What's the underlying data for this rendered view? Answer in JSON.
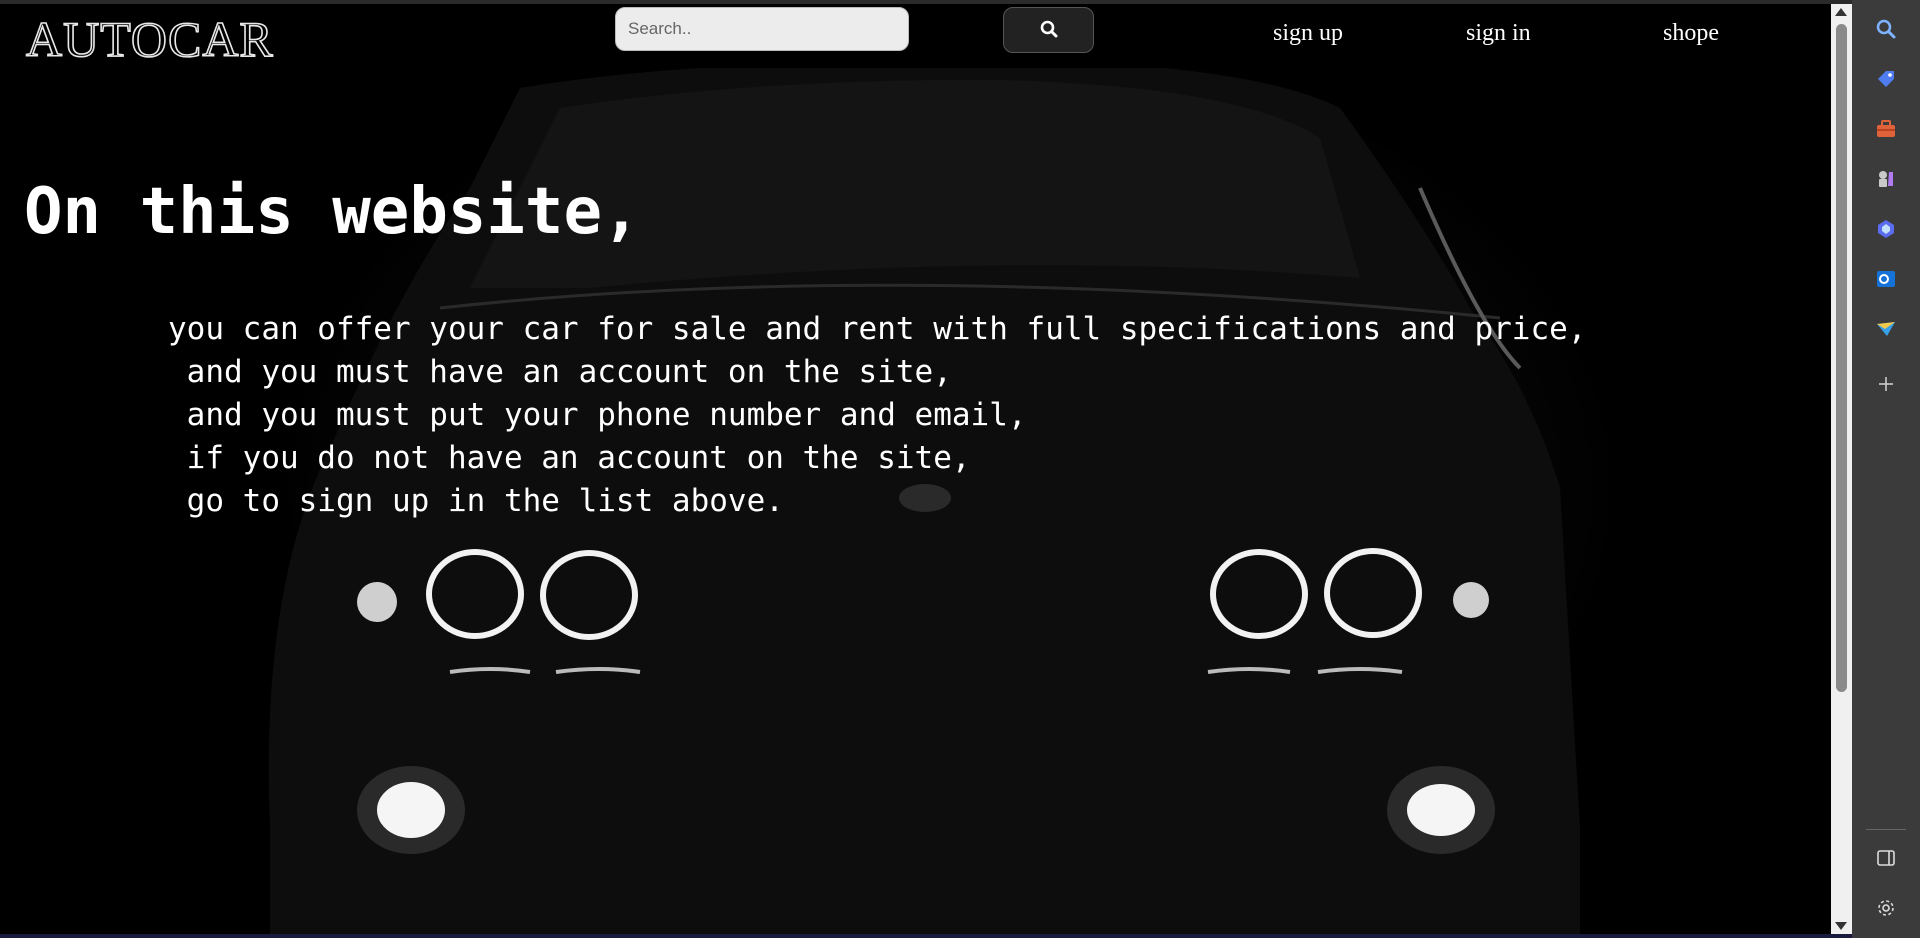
{
  "brand": {
    "logo_text": "AUTOCAR"
  },
  "search": {
    "placeholder": "Search..",
    "value": "",
    "button_icon": "search-icon"
  },
  "nav": {
    "links": [
      "sign up",
      "sign in",
      "shope"
    ]
  },
  "hero": {
    "title": "On this website,",
    "lines": [
      "you can offer your car for sale and rent with full specifications and price,",
      " and you must have an account on the site,",
      " and you must put your phone number and email,",
      " if you do not have an account on the site,",
      " go to sign up in the list above."
    ]
  },
  "edge_sidebar": {
    "icons": [
      "search-icon",
      "tag-icon",
      "toolbox-icon",
      "chess-icon",
      "copilot-icon",
      "outlook-icon",
      "send-icon",
      "add-icon",
      "sidebar-panel-icon",
      "settings-icon"
    ]
  },
  "colors": {
    "page_bg": "#000000",
    "text": "#ffffff",
    "search_bg": "#ececec",
    "button_bg": "#222222",
    "browser_chrome": "#3b3b3b"
  }
}
